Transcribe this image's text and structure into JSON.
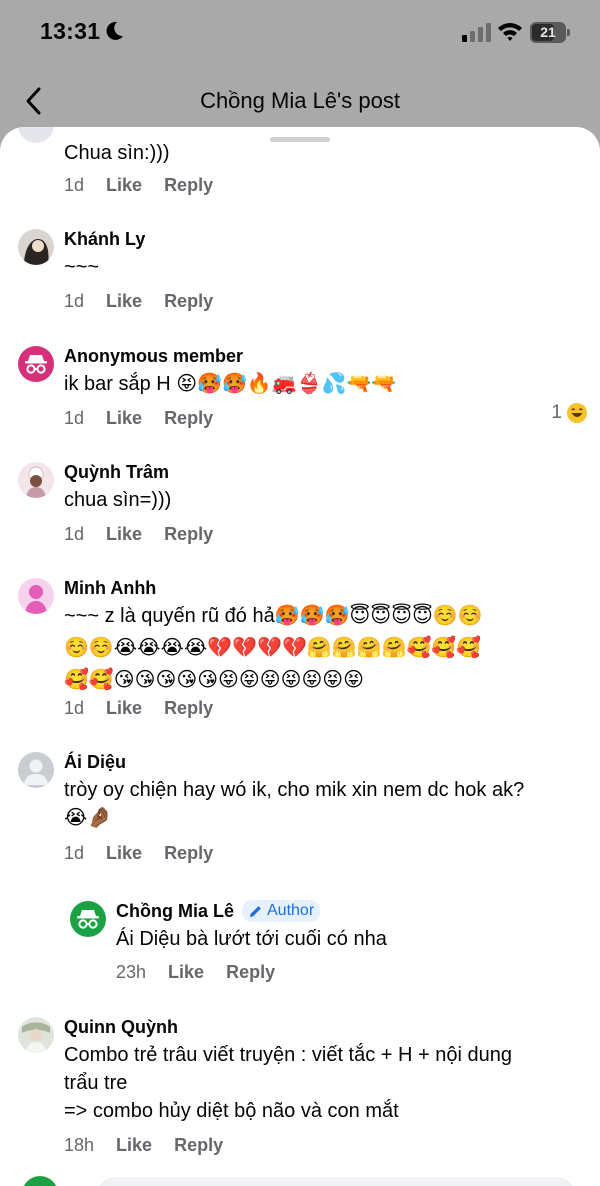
{
  "status": {
    "time": "13:31",
    "battery": "21"
  },
  "nav": {
    "title": "Chồng Mia Lê's post"
  },
  "comments": [
    {
      "name": "",
      "text": "Chua sìn:)))",
      "time": "1d",
      "like": "Like",
      "reply": "Reply"
    },
    {
      "name": "Khánh Ly",
      "text": "~~~",
      "time": "1d",
      "like": "Like",
      "reply": "Reply"
    },
    {
      "name": "Anonymous member",
      "text": "ik bar sắp H 😝🥵🥵🔥🚒👙💦🔫🔫",
      "time": "1d",
      "like": "Like",
      "reply": "Reply",
      "reaction_count": "1",
      "reaction_icon": "laughing-face"
    },
    {
      "name": "Quỳnh Trâm",
      "text": "chua sìn=)))",
      "time": "1d",
      "like": "Like",
      "reply": "Reply"
    },
    {
      "name": "Minh Anhh",
      "text": "~~~ z là quyến rũ đó hả🥵🥵🥵😇😇😇😇☺️☺️\n☺️☺️😭😭😭😭💔💔💔💔🤗🤗🤗🤗🥰🥰🥰\n🥰🥰😘😘😘😘😘😝😝😝😝😝😝😝",
      "time": "1d",
      "like": "Like",
      "reply": "Reply"
    },
    {
      "name": "Ái Diệu",
      "text": "tròy oy chiện hay wó ik, cho mik xin nem dc hok ak?\n😭🤌🏾",
      "time": "1d",
      "like": "Like",
      "reply": "Reply"
    },
    {
      "name": "Chồng Mia Lê",
      "badge": "Author",
      "text": "Ái Diệu bà lướt tới cuối có nha",
      "time": "23h",
      "like": "Like",
      "reply": "Reply"
    },
    {
      "name": "Quinn Quỳnh",
      "text": "Combo trẻ trâu viết truyện : viết tắc + H + nội dung\ntrẩu tre\n=> combo hủy diệt bộ não và con mắt",
      "time": "18h",
      "like": "Like",
      "reply": "Reply"
    }
  ],
  "colors": {
    "author_green": "#1aa245",
    "anon_pink": "#d6307a",
    "badge_blue": "#1b6fe0",
    "meta_gray": "#65676b"
  }
}
